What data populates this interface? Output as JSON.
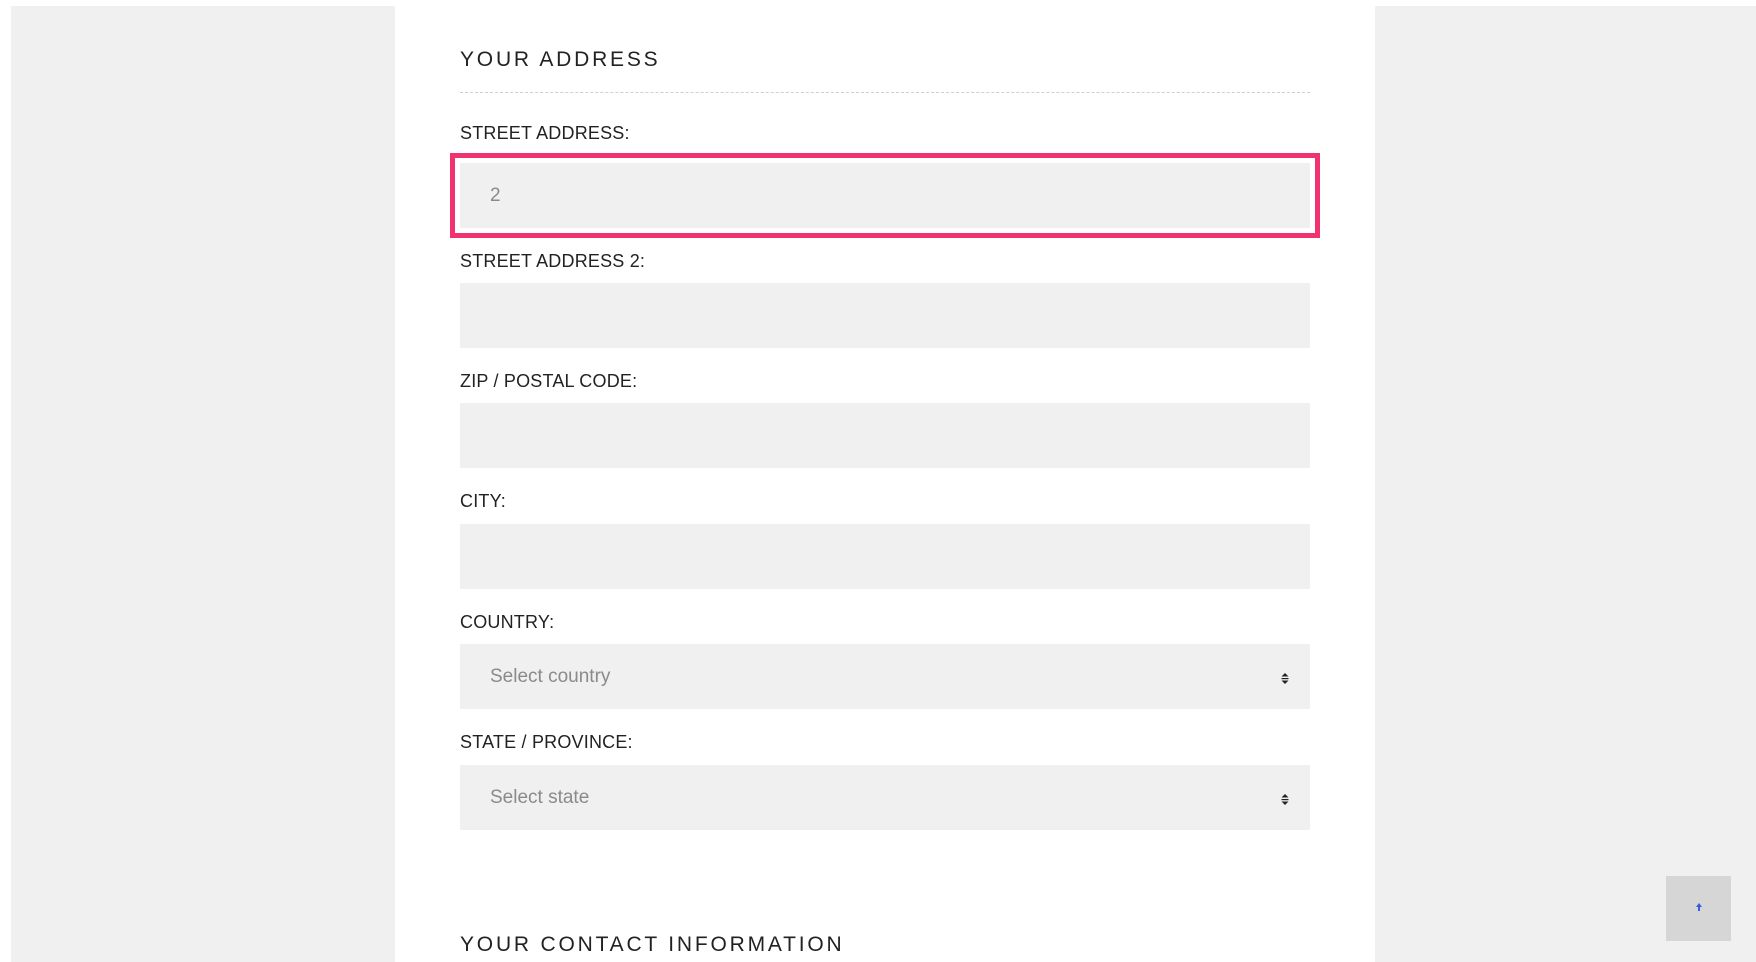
{
  "address_section": {
    "title": "YOUR ADDRESS",
    "street_address": {
      "label": "STREET ADDRESS:",
      "value": "2"
    },
    "street_address_2": {
      "label": "STREET ADDRESS 2:",
      "value": ""
    },
    "zip": {
      "label": "ZIP / POSTAL CODE:",
      "value": ""
    },
    "city": {
      "label": "CITY:",
      "value": ""
    },
    "country": {
      "label": "COUNTRY:",
      "placeholder": "Select country"
    },
    "state": {
      "label": "STATE / PROVINCE:",
      "placeholder": "Select state"
    }
  },
  "contact_section": {
    "title": "YOUR CONTACT INFORMATION"
  },
  "icons": {
    "select_arrows": "sort-arrows-icon",
    "scroll_top": "arrow-up-icon"
  },
  "colors": {
    "highlight": "#f0326e",
    "field_background": "#f0f0f0",
    "page_background": "#f0f0f0",
    "scroll_top_button": "#d6d6d6",
    "scroll_top_arrow": "#3b5bdb"
  }
}
